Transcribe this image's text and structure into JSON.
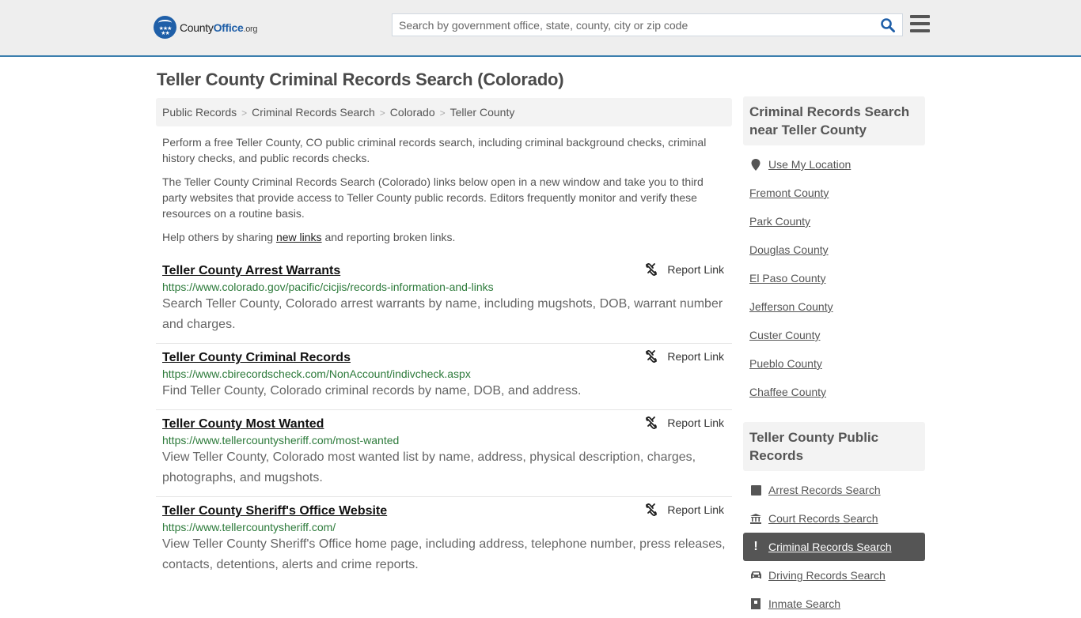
{
  "header": {
    "logo": {
      "name_part1": "County",
      "name_part2": "Office",
      "name_part3": ".org"
    },
    "search": {
      "placeholder": "Search by government office, state, county, city or zip code",
      "value": ""
    },
    "colors": {
      "brand_blue": "#1f5fa8",
      "header_border": "#3c7fae"
    }
  },
  "page": {
    "title": "Teller County Criminal Records Search (Colorado)",
    "breadcrumb": [
      "Public Records",
      "Criminal Records Search",
      "Colorado",
      "Teller County"
    ],
    "intro": {
      "p1": "Perform a free Teller County, CO public criminal records search, including criminal background checks, criminal history checks, and public records checks.",
      "p2": "The Teller County Criminal Records Search (Colorado) links below open in a new window and take you to third party websites that provide access to Teller County public records. Editors frequently monitor and verify these resources on a routine basis.",
      "p3_before": "Help others by sharing ",
      "p3_link": "new links",
      "p3_after": " and reporting broken links."
    }
  },
  "results": [
    {
      "title": "Teller County Arrest Warrants",
      "url": "https://www.colorado.gov/pacific/cicjis/records-information-and-links",
      "description": "Search Teller County, Colorado arrest warrants by name, including mugshots, DOB, warrant number and charges.",
      "report_label": "Report Link"
    },
    {
      "title": "Teller County Criminal Records",
      "url": "https://www.cbirecordscheck.com/NonAccount/indivcheck.aspx",
      "description": "Find Teller County, Colorado criminal records by name, DOB, and address.",
      "report_label": "Report Link"
    },
    {
      "title": "Teller County Most Wanted",
      "url": "https://www.tellercountysheriff.com/most-wanted",
      "description": "View Teller County, Colorado most wanted list by name, address, physical description, charges, photographs, and mugshots.",
      "report_label": "Report Link"
    },
    {
      "title": "Teller County Sheriff's Office Website",
      "url": "https://www.tellercountysheriff.com/",
      "description": "View Teller County Sheriff's Office home page, including address, telephone number, press releases, contacts, detentions, alerts and crime reports.",
      "report_label": "Report Link"
    }
  ],
  "sidebar": {
    "nearby": {
      "heading": "Criminal Records Search near Teller County",
      "use_location": "Use My Location",
      "items": [
        "Fremont County",
        "Park County",
        "Douglas County",
        "El Paso County",
        "Jefferson County",
        "Custer County",
        "Pueblo County",
        "Chaffee County"
      ]
    },
    "public_records": {
      "heading": "Teller County Public Records",
      "items": [
        {
          "label": "Arrest Records Search",
          "icon": "square-icon",
          "active": false
        },
        {
          "label": "Court Records Search",
          "icon": "courthouse-icon",
          "active": false
        },
        {
          "label": "Criminal Records Search",
          "icon": "exclamation-icon",
          "active": true
        },
        {
          "label": "Driving Records Search",
          "icon": "car-icon",
          "active": false
        },
        {
          "label": "Inmate Search",
          "icon": "inmate-icon",
          "active": false
        }
      ]
    }
  }
}
